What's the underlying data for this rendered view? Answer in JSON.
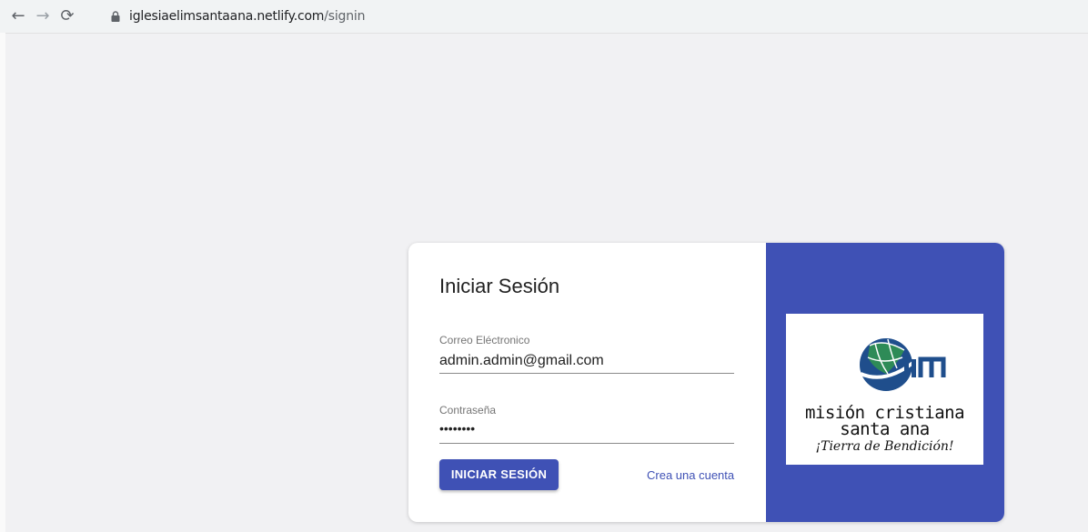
{
  "browser": {
    "url_domain": "iglesiaelimsantaana.netlify.com",
    "url_path": "/signin",
    "icons": [
      "back-arrow-icon",
      "forward-arrow-icon",
      "reload-icon",
      "lock-icon"
    ]
  },
  "signin": {
    "title": "Iniciar Sesión",
    "email_label": "Correo Eléctronico",
    "email_value": "admin.admin@gmail.com",
    "password_label": "Contraseña",
    "password_value": "••••••••",
    "submit_label": "INICIAR SESIÓN",
    "create_account_link": "Crea una cuenta"
  },
  "logo": {
    "mark": "elim",
    "line1": "misión cristiana",
    "line2": "santa ana",
    "tagline": "¡Tierra de Bendición!"
  },
  "colors": {
    "primary": "#3f51b5",
    "background": "#f1f1f3",
    "logo_green": "#2e8b57",
    "logo_blue": "#1f4e8c"
  }
}
